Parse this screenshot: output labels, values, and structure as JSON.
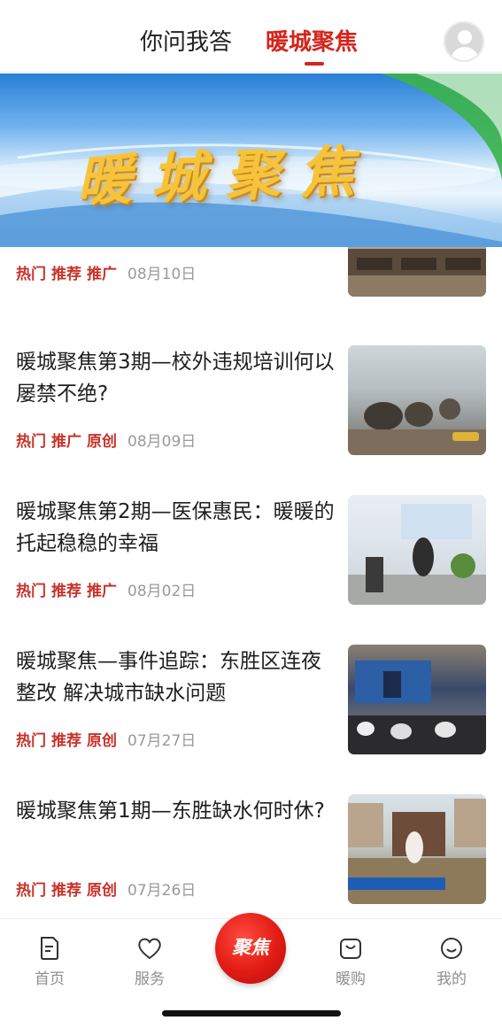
{
  "header": {
    "tabs": [
      {
        "label": "你问我答",
        "active": false
      },
      {
        "label": "暖城聚焦",
        "active": true
      }
    ],
    "accent_color": "#d6241c"
  },
  "banner": {
    "title": "暖城聚焦"
  },
  "feed": {
    "items": [
      {
        "title": "",
        "tags": [
          "热门",
          "推荐",
          "推广"
        ],
        "date": "08月10日"
      },
      {
        "title": "暖城聚焦第3期—校外违规培训何以屡禁不绝?",
        "tags": [
          "热门",
          "推广",
          "原创"
        ],
        "date": "08月09日"
      },
      {
        "title": "暖城聚焦第2期—医保惠民：暖暖的托起稳稳的幸福",
        "tags": [
          "热门",
          "推荐",
          "推广"
        ],
        "date": "08月02日"
      },
      {
        "title": "暖城聚焦—事件追踪：东胜区连夜整改 解决城市缺水问题",
        "tags": [
          "热门",
          "推荐",
          "原创"
        ],
        "date": "07月27日"
      },
      {
        "title": "暖城聚焦第1期—东胜缺水何时休?",
        "tags": [
          "热门",
          "推荐",
          "原创"
        ],
        "date": "07月26日"
      }
    ]
  },
  "bottom_nav": {
    "items": [
      {
        "label": "首页",
        "icon": "document-icon"
      },
      {
        "label": "服务",
        "icon": "heart-icon"
      },
      {
        "label": "暖购",
        "icon": "shopping-bag-icon"
      },
      {
        "label": "我的",
        "icon": "smile-icon"
      }
    ],
    "center_button": "聚焦"
  }
}
